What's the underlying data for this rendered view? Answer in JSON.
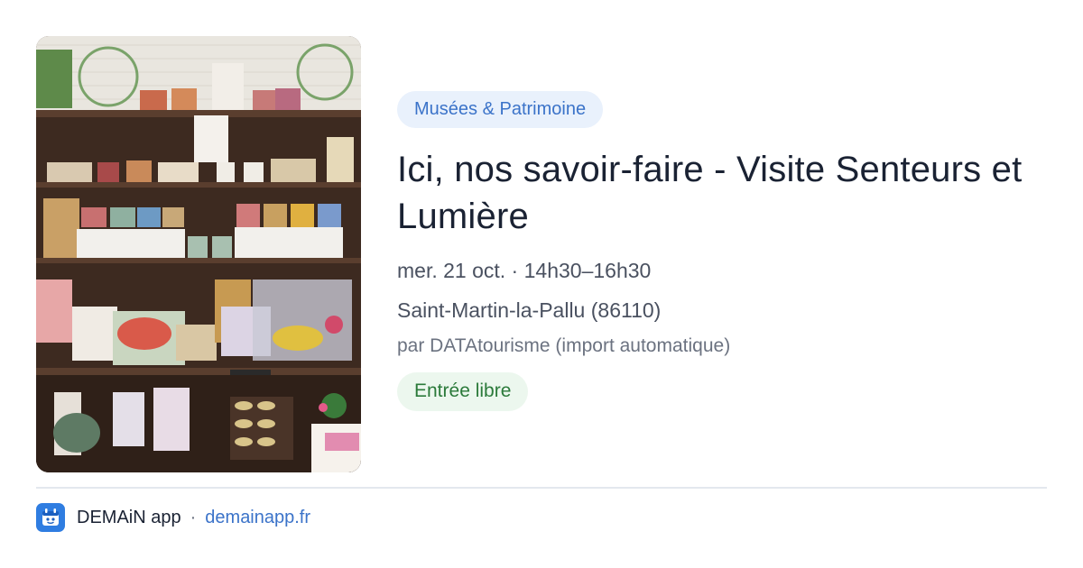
{
  "event": {
    "category": "Musées & Patrimoine",
    "title": "Ici, nos savoir-faire - Visite Senteurs et Lumière",
    "date": "mer. 21 oct. · 14h30–16h30",
    "location": "Saint-Martin-la-Pallu (86110)",
    "source": "par DATAtourisme (import automatique)",
    "price": "Entrée libre",
    "image_icon": "shop-shelves-photo"
  },
  "footer": {
    "app_name": "DEMAiN app",
    "separator": "·",
    "domain": "demainapp.fr",
    "logo_icon": "demain-app-logo-icon"
  },
  "colors": {
    "accent_blue": "#3b73c9",
    "category_bg": "#e9f1fc",
    "price_green": "#2b7a3a",
    "price_bg": "#ecf7ee",
    "logo_blue": "#2f7de1"
  }
}
